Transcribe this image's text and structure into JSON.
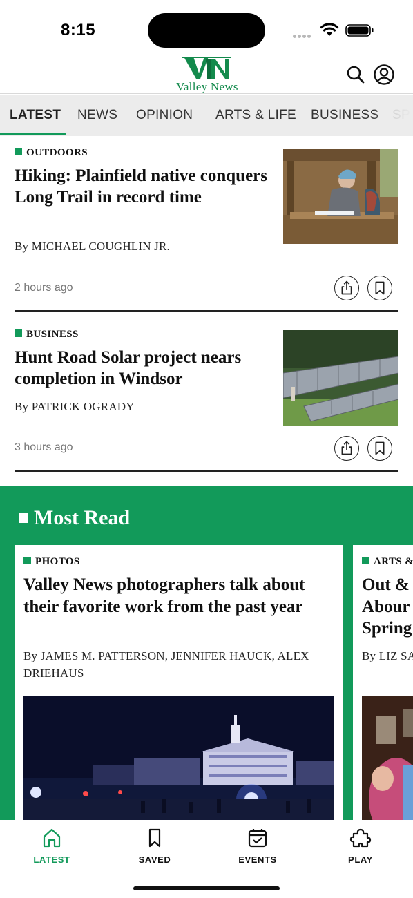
{
  "status_bar": {
    "time": "8:15"
  },
  "brand": {
    "name": "Valley News",
    "color": "#129a5a"
  },
  "header": {
    "search_icon": "search-icon",
    "account_icon": "account-icon"
  },
  "tabs": [
    {
      "label": "LATEST",
      "active": true
    },
    {
      "label": "NEWS"
    },
    {
      "label": "OPINION"
    },
    {
      "label": "ARTS & LIFE"
    },
    {
      "label": "BUSINESS"
    },
    {
      "label": "SP"
    }
  ],
  "articles": [
    {
      "section": "OUTDOORS",
      "headline": "Hiking: Plainfield native conquers Long Trail in record time",
      "byline": "By MICHAEL COUGHLIN JR.",
      "time": "2 hours ago"
    },
    {
      "section": "BUSINESS",
      "headline": "Hunt Road Solar project nears completion in Windsor",
      "byline": "By PATRICK OGRADY",
      "time": "3 hours ago"
    }
  ],
  "most_read": {
    "title": "Most Read",
    "cards": [
      {
        "section": "PHOTOS",
        "headline": "Valley News photographers talk about their favorite work from the past year",
        "byline": "By JAMES M. PATTERSON, JENNIFER HAUCK, ALEX DRIEHAUS"
      },
      {
        "section": "ARTS &",
        "headline": "Out & Abour Spring",
        "byline": "By LIZ SA"
      }
    ]
  },
  "bottom_nav": [
    {
      "label": "LATEST",
      "icon": "home-icon",
      "active": true
    },
    {
      "label": "SAVED",
      "icon": "bookmark-icon"
    },
    {
      "label": "EVENTS",
      "icon": "calendar-icon"
    },
    {
      "label": "PLAY",
      "icon": "puzzle-icon"
    }
  ]
}
